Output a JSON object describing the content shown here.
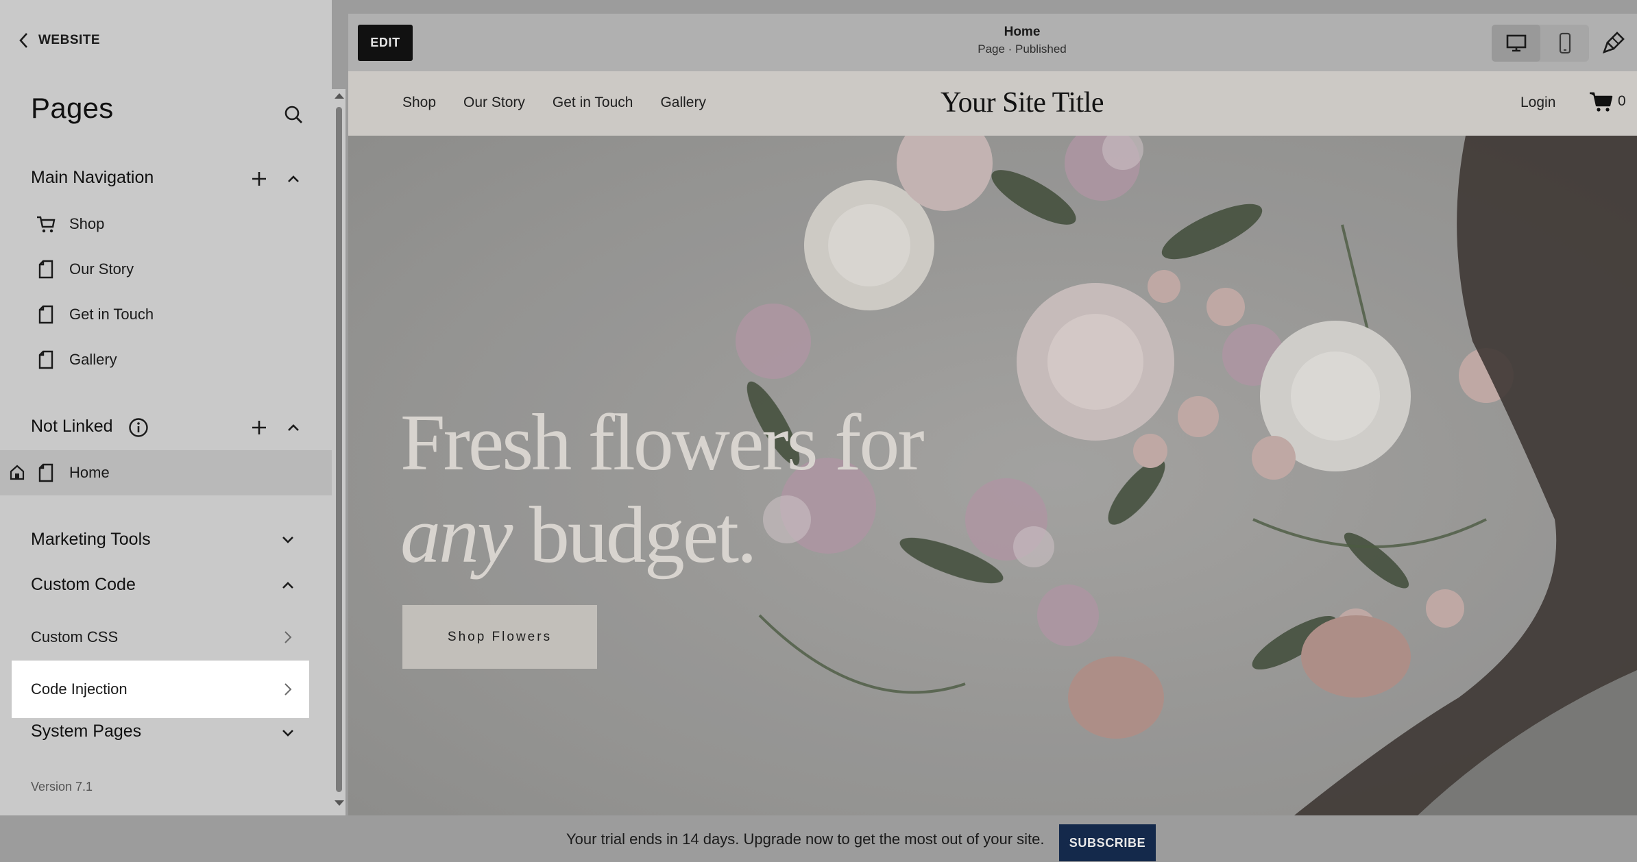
{
  "sidebar": {
    "back_label": "WEBSITE",
    "title": "Pages",
    "main_nav": {
      "heading": "Main Navigation",
      "items": [
        {
          "label": "Shop",
          "icon": "cart-icon"
        },
        {
          "label": "Our Story",
          "icon": "page-icon"
        },
        {
          "label": "Get in Touch",
          "icon": "page-icon"
        },
        {
          "label": "Gallery",
          "icon": "page-icon"
        }
      ]
    },
    "not_linked": {
      "heading": "Not Linked",
      "items": [
        {
          "label": "Home",
          "icon": "page-icon",
          "is_homepage": true
        }
      ]
    },
    "marketing_tools": {
      "heading": "Marketing Tools"
    },
    "custom_code": {
      "heading": "Custom Code",
      "items": [
        {
          "label": "Custom CSS"
        },
        {
          "label": "Code Injection"
        }
      ]
    },
    "system_pages": {
      "heading": "System Pages"
    },
    "version": "Version 7.1"
  },
  "editor": {
    "edit_label": "EDIT",
    "page_title": "Home",
    "page_status": "Page · Published"
  },
  "site": {
    "nav": [
      "Shop",
      "Our Story",
      "Get in Touch",
      "Gallery"
    ],
    "title": "Your Site Title",
    "login": "Login",
    "cart_count": "0",
    "hero": {
      "line1": "Fresh flowers for",
      "line2_italic": "any",
      "line2_rest": " budget.",
      "button": "Shop Flowers"
    }
  },
  "trial": {
    "message": "Your trial ends in 14 days. Upgrade now to get the most out of your site.",
    "button": "SUBSCRIBE"
  },
  "colors": {
    "subscribe_bg": "#14294b",
    "edit_bg": "#111111",
    "selected_item_bg": "#ffffff"
  }
}
